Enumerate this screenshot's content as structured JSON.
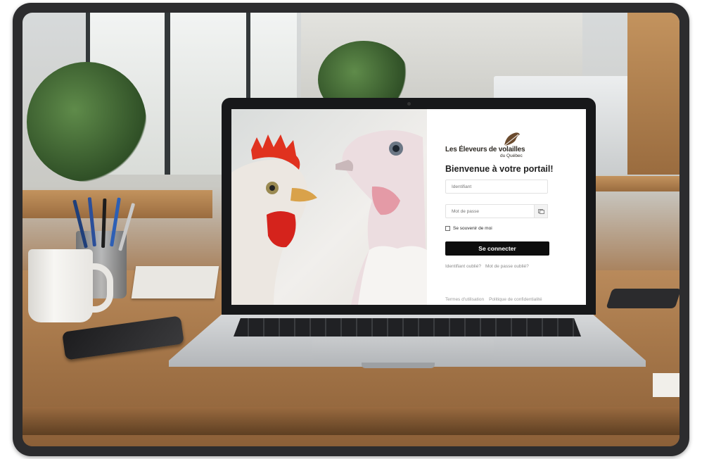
{
  "brand": {
    "name": "Les Éleveurs de volailles",
    "region": "du Québec"
  },
  "login": {
    "heading": "Bienvenue à votre portail!",
    "username_placeholder": "Identifiant",
    "password_placeholder": "Mot de passe",
    "remember_label": "Se souvenir de moi",
    "submit_label": "Se connecter",
    "forgot_username": "Identifiant oublié?",
    "forgot_password": "Mot de passe oublié?"
  },
  "footer": {
    "terms": "Termes d'utilisation",
    "privacy": "Politique de confidentialité"
  },
  "colors": {
    "button": "#0d0d0d",
    "logo_leaf": "#6b4b2e"
  },
  "icons": {
    "password_toggle": "eye-icon",
    "logo": "leaf-logo-icon"
  }
}
